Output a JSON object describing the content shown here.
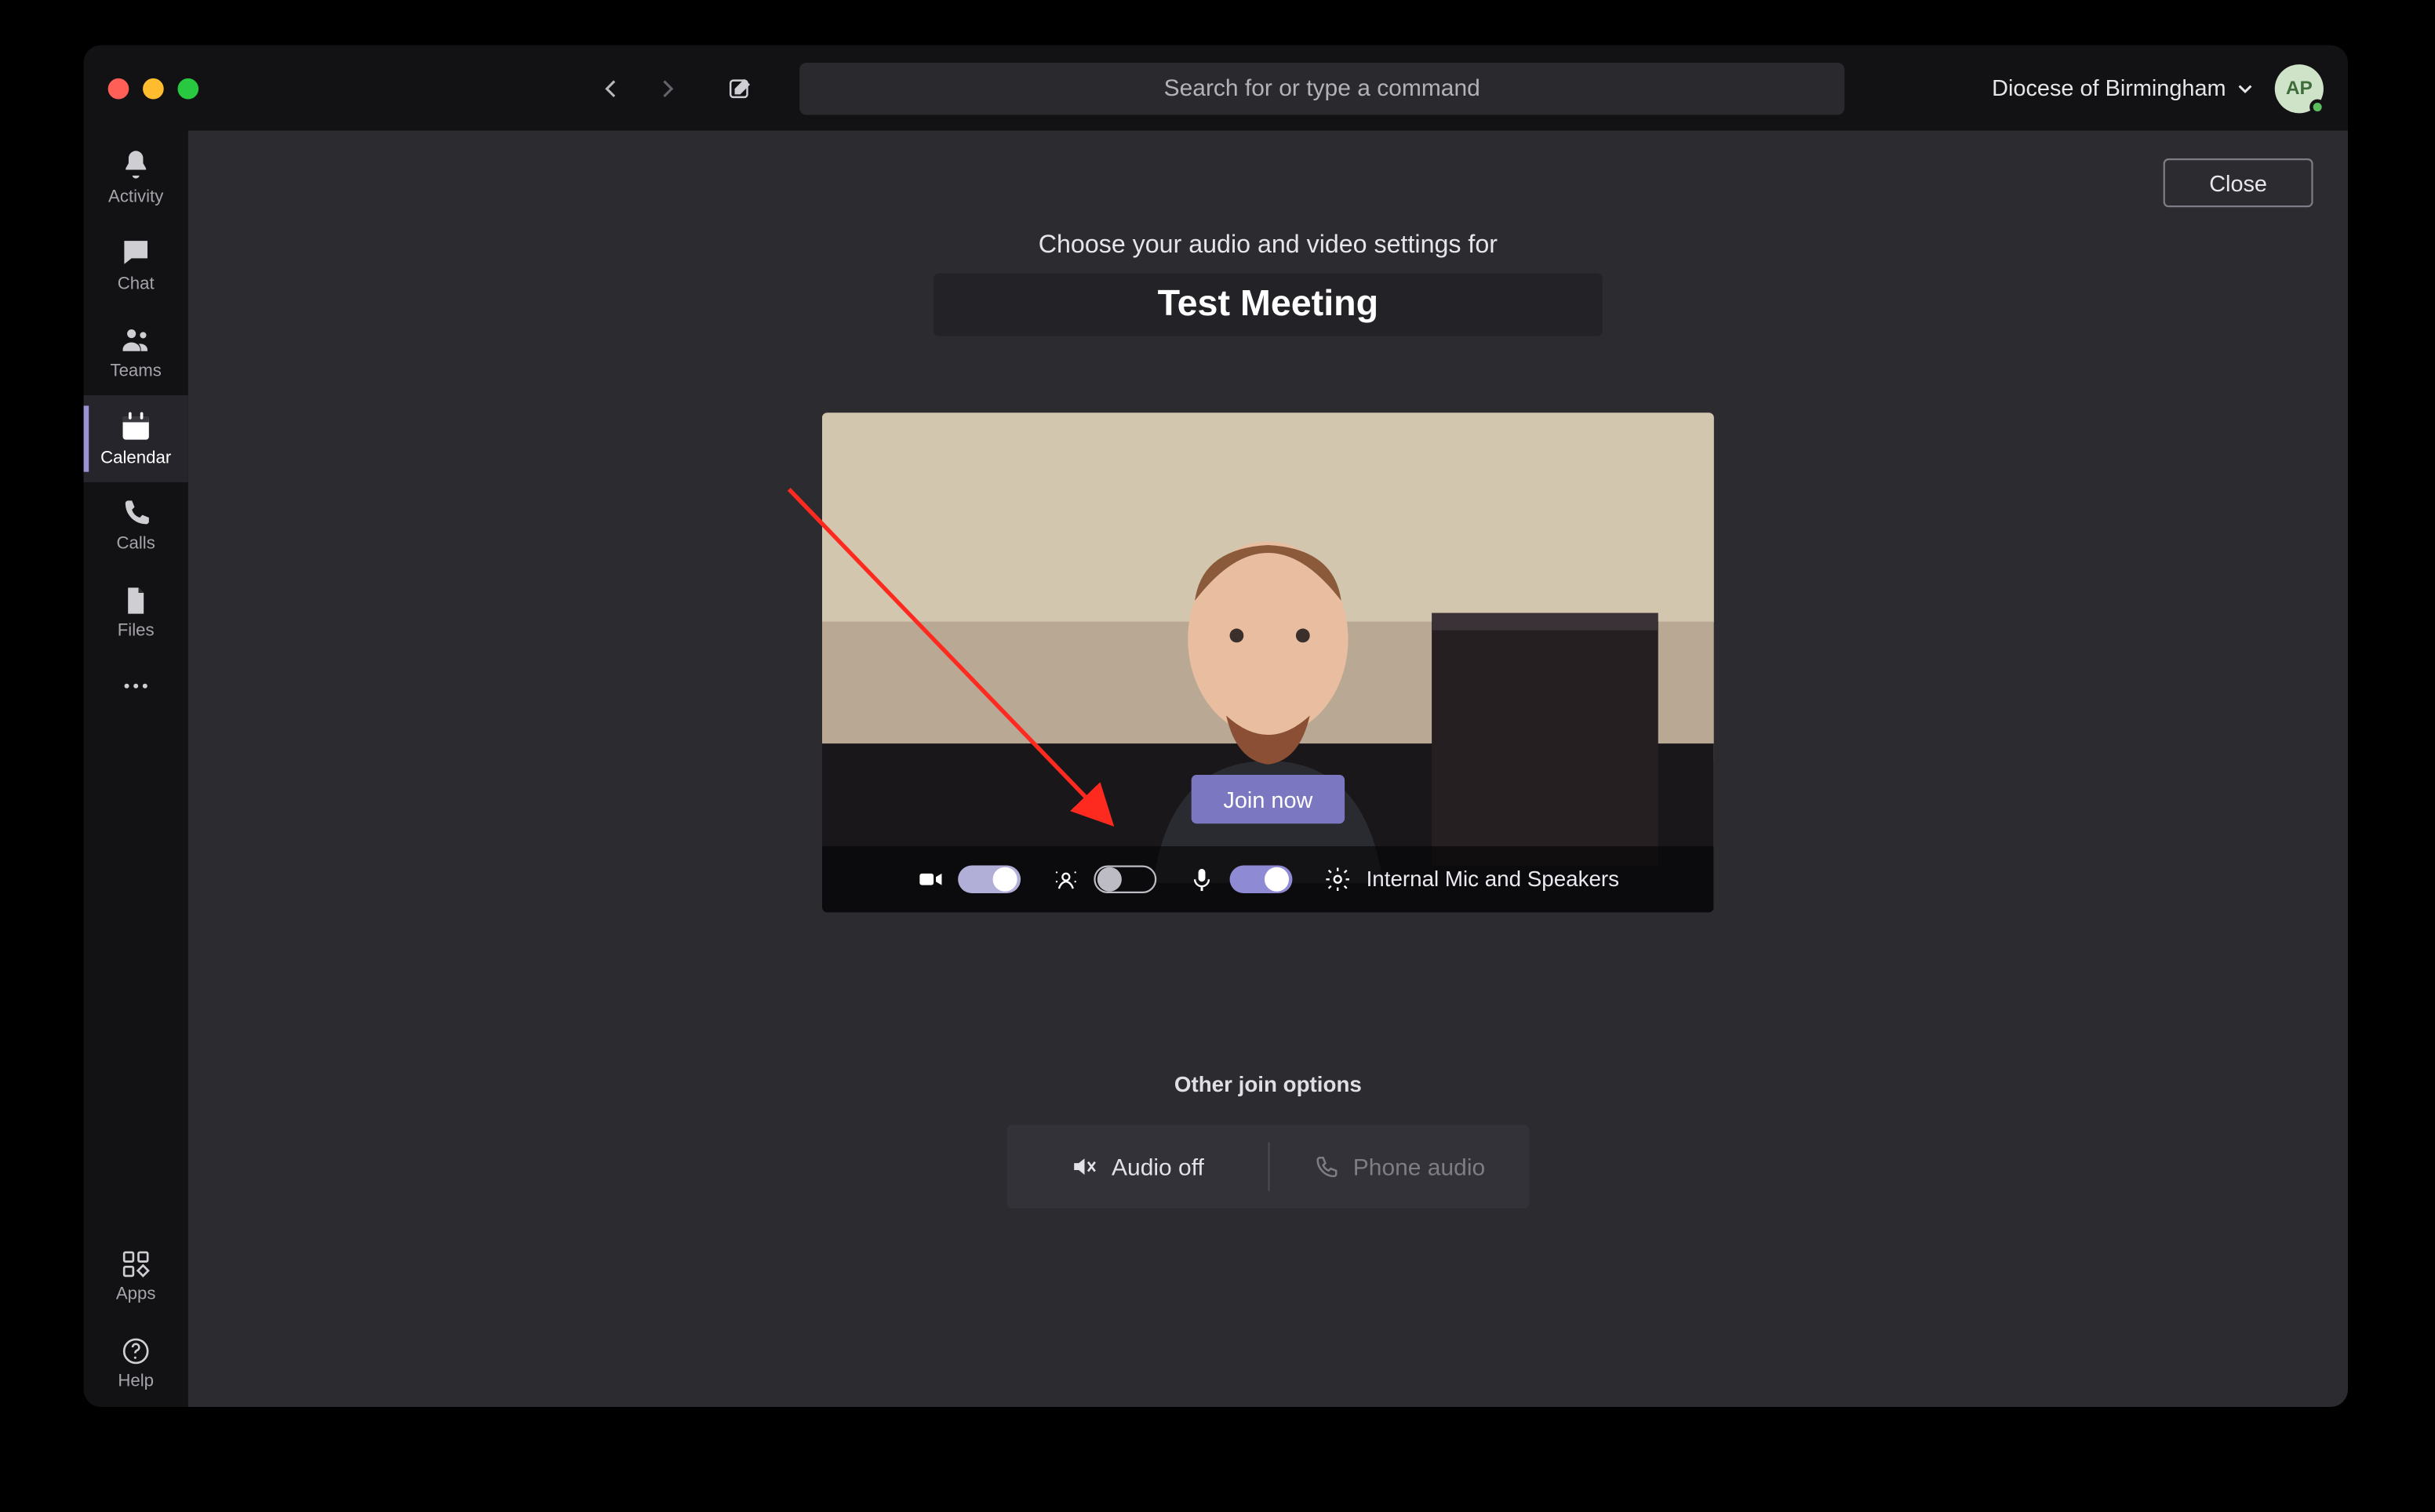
{
  "titlebar": {
    "search_placeholder": "Search for or type a command",
    "org_name": "Diocese of Birmingham",
    "avatar_initials": "AP"
  },
  "rail": {
    "items": [
      {
        "key": "activity",
        "label": "Activity"
      },
      {
        "key": "chat",
        "label": "Chat"
      },
      {
        "key": "teams",
        "label": "Teams"
      },
      {
        "key": "calendar",
        "label": "Calendar"
      },
      {
        "key": "calls",
        "label": "Calls"
      },
      {
        "key": "files",
        "label": "Files"
      }
    ],
    "apps_label": "Apps",
    "help_label": "Help",
    "selected": "calendar"
  },
  "main": {
    "close_label": "Close",
    "headline": "Choose your audio and video settings for",
    "meeting_name": "Test Meeting",
    "join_label": "Join now",
    "controls": {
      "camera_on": true,
      "blur_on": false,
      "mic_on": true,
      "device_label": "Internal Mic and Speakers"
    },
    "other_options_label": "Other join options",
    "audio_off_label": "Audio off",
    "phone_audio_label": "Phone audio"
  }
}
